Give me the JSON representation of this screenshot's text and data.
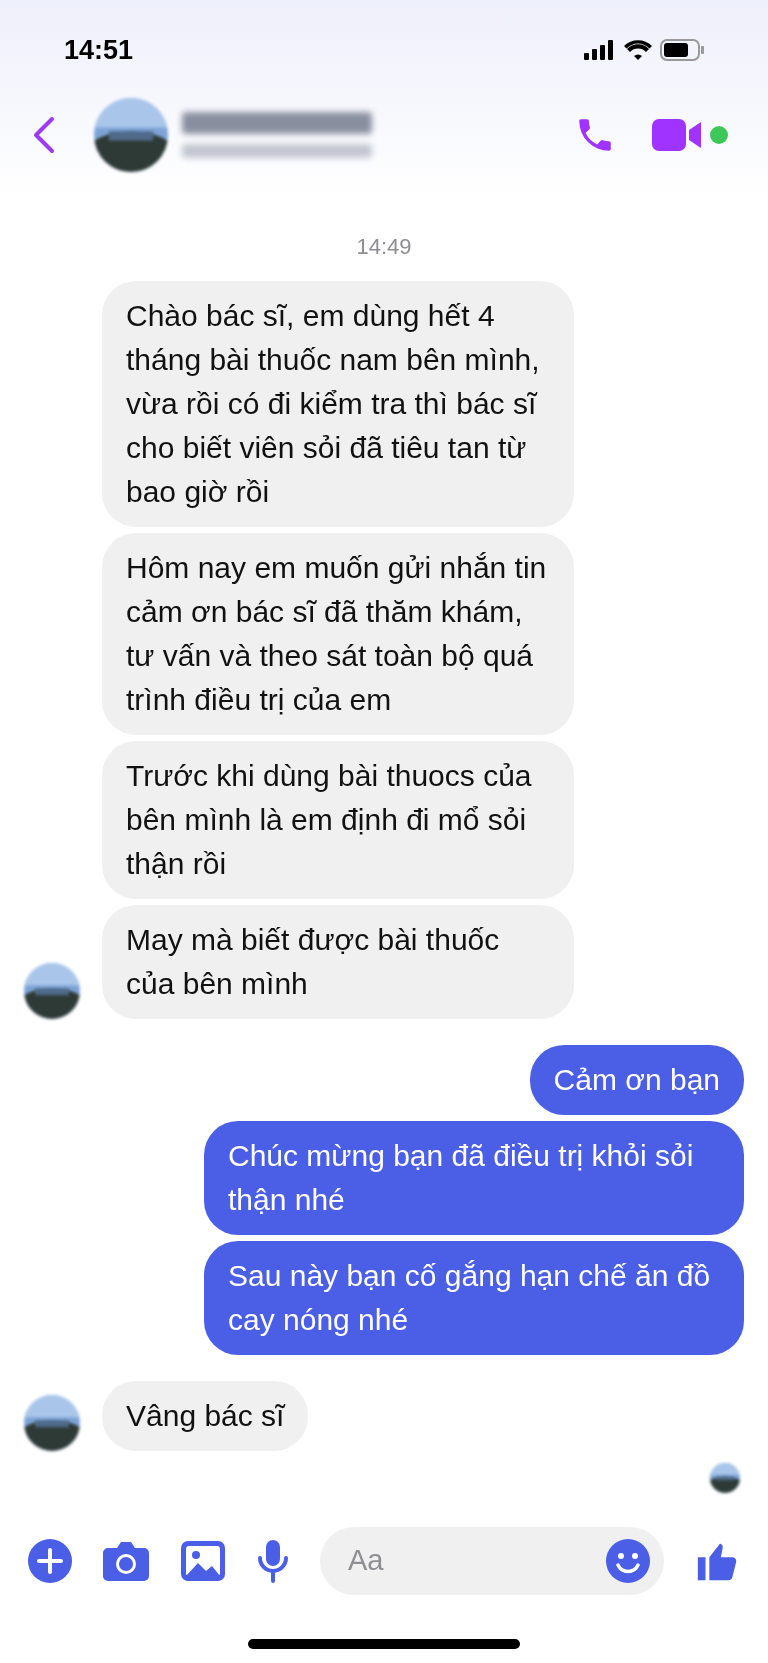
{
  "status_bar": {
    "time": "14:51"
  },
  "chat": {
    "timestamp": "14:49",
    "messages": [
      {
        "kind": "received",
        "text": "Chào bác sĩ, em dùng hết 4 tháng bài thuốc nam bên mình, vừa rồi có đi kiểm tra thì bác sĩ cho biết viên sỏi đã tiêu tan từ bao giờ rồi",
        "show_avatar": false
      },
      {
        "kind": "received",
        "text": "Hôm nay em muốn gửi nhắn tin cảm ơn bác sĩ đã thăm khám, tư vấn và theo sát toàn bộ quá trình điều trị của em",
        "show_avatar": false
      },
      {
        "kind": "received",
        "text": "Trước khi dùng bài thuocs của bên mình là em định đi mổ sỏi thận rồi",
        "show_avatar": false
      },
      {
        "kind": "received",
        "text": "May mà biết được bài thuốc của bên mình",
        "show_avatar": true
      },
      {
        "kind": "sent",
        "text": "Cảm ơn bạn"
      },
      {
        "kind": "sent",
        "text": "Chúc mừng bạn đã điều trị khỏi sỏi thận nhé"
      },
      {
        "kind": "sent",
        "text": "Sau này bạn cố gắng hạn chế ăn đồ cay nóng nhé"
      },
      {
        "kind": "received",
        "text": "Vâng bác sĩ",
        "show_avatar": true
      }
    ]
  },
  "composer": {
    "placeholder": "Aa"
  }
}
